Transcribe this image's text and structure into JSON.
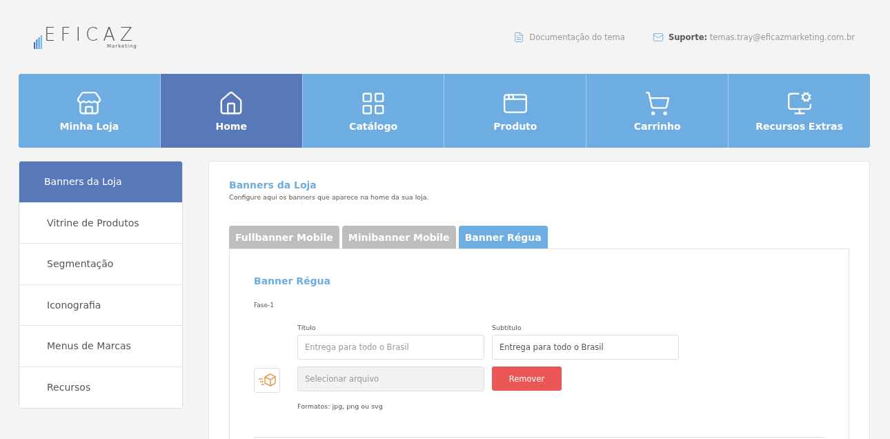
{
  "logo": {
    "name": "EFICAZ",
    "tagline": "Marketing"
  },
  "header_links": [
    {
      "kind": "doc",
      "text": "Documentação do tema"
    },
    {
      "kind": "mail",
      "text": "**Suporte:** temas.tray@eficazmarketing.com.br"
    }
  ],
  "nav": [
    {
      "label": "Minha Loja",
      "selected": false
    },
    {
      "label": "Home",
      "selected": true
    },
    {
      "label": "Catálogo",
      "selected": false
    },
    {
      "label": "Produto",
      "selected": false
    },
    {
      "label": "Carrinho",
      "selected": false
    },
    {
      "label": "Recursos Extras",
      "selected": false
    }
  ],
  "sidebar": {
    "items": [
      {
        "label": "Banners da Loja",
        "selected": true
      },
      {
        "label": "Vitrine de Produtos",
        "selected": false
      },
      {
        "label": "Segmentação",
        "selected": false
      },
      {
        "label": "Iconografia",
        "selected": false
      },
      {
        "label": "Menus de Marcas",
        "selected": false
      },
      {
        "label": "Recursos",
        "selected": false
      }
    ]
  },
  "content": {
    "title": "Banners da Loja",
    "subtitle": "Configure aqui os banners que aparece na home da sua loja.",
    "tabs": [
      {
        "label": "Fullbanner Mobile",
        "selected": false
      },
      {
        "label": "Minibanner Mobile",
        "selected": false
      },
      {
        "label": "Banner Régua",
        "selected": true
      }
    ],
    "section_title": "Banner Régua",
    "phase": "Fase-1",
    "fields": [
      {
        "label": "Título",
        "placeholder": "Entrega para todo o Brasil"
      },
      {
        "label": "Subtítulo",
        "value": "Entrega para todo o Brasil"
      }
    ],
    "file": {
      "placeholder": "Selecionar arquivo",
      "disabled": true
    },
    "remove_button": "Remover",
    "formats": "Formatos: jpg, png ou svg"
  }
}
